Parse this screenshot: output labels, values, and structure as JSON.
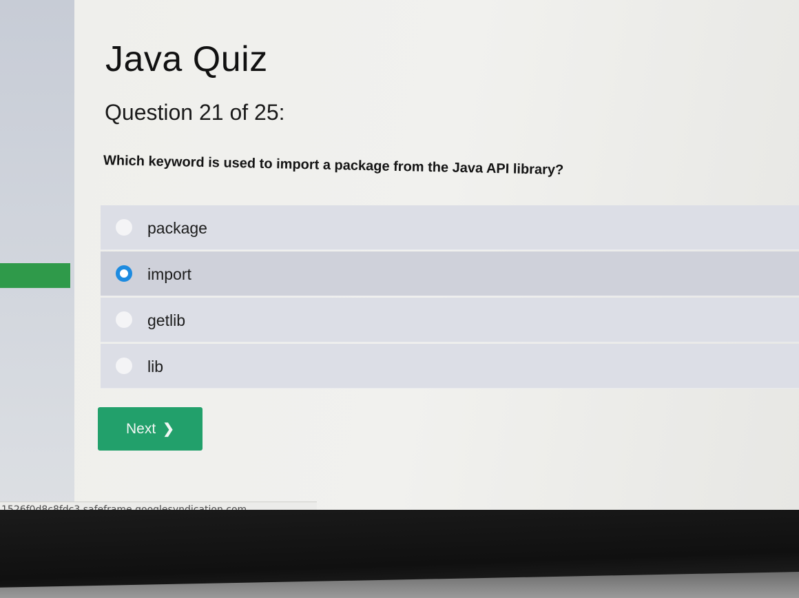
{
  "quiz": {
    "title": "Java Quiz",
    "question_count": "Question 21 of 25:",
    "question_text": "Which keyword is used to import a package from the Java API library?",
    "options": [
      {
        "label": "package",
        "selected": false
      },
      {
        "label": "import",
        "selected": true
      },
      {
        "label": "getlib",
        "selected": false
      },
      {
        "label": "lib",
        "selected": false
      }
    ],
    "next_label": "Next",
    "next_icon": "chevron-right-icon"
  },
  "status_bar": {
    "url": "1526f0d8c8fdc3.safeframe.googlesyndication.com"
  },
  "colors": {
    "next_button": "#22a06b",
    "radio_selected": "#1d8be0",
    "sidebar_marker": "#2f9a4a"
  }
}
